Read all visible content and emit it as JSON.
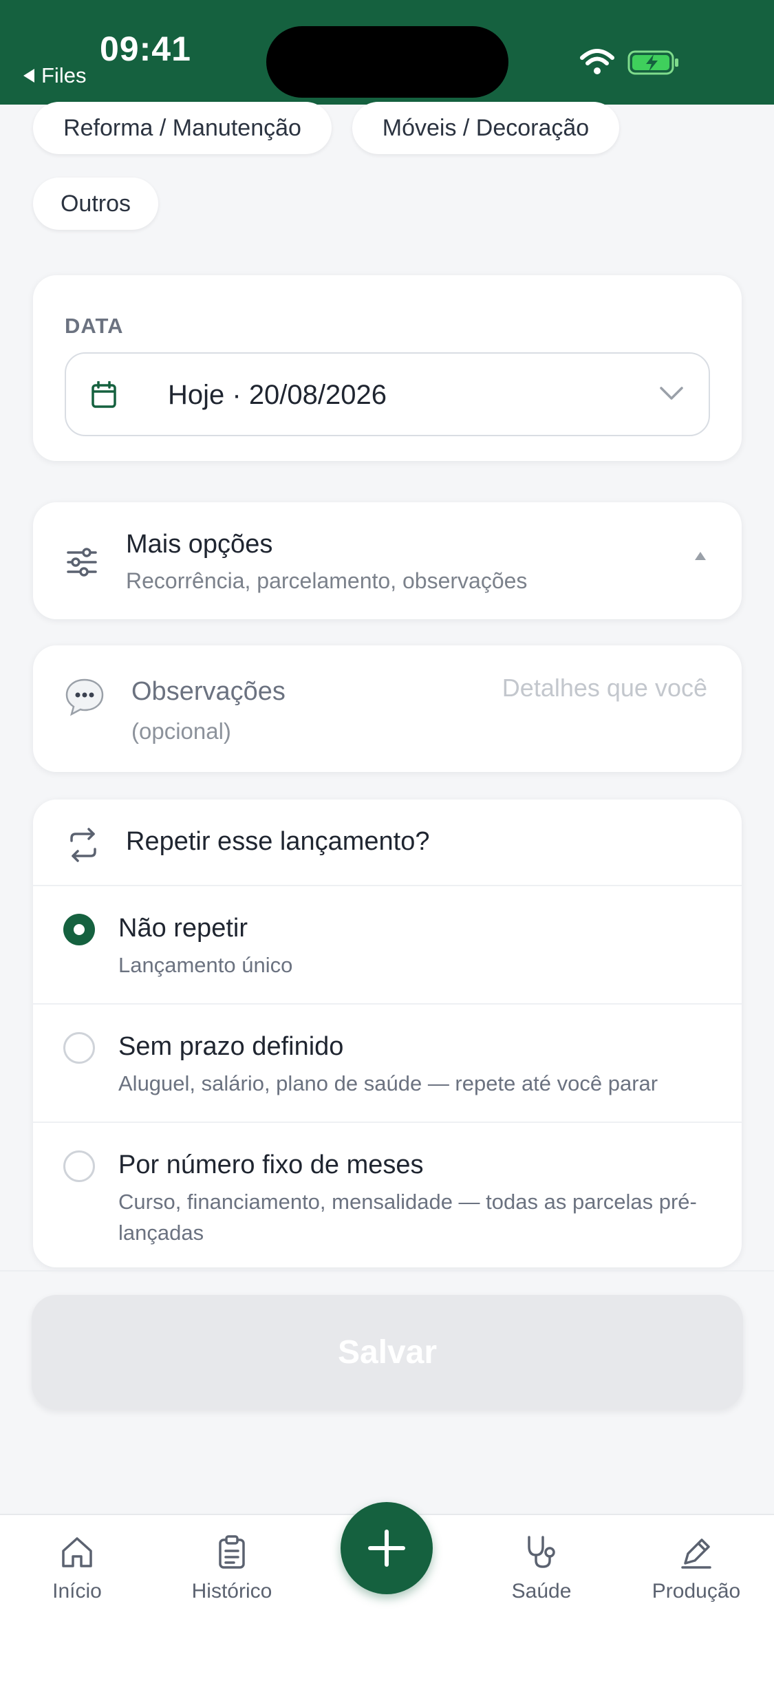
{
  "status_bar": {
    "time": "09:41",
    "back_label": "Files"
  },
  "chips": {
    "reforma": "Reforma / Manutenção",
    "moveis": "Móveis / Decoração",
    "outros": "Outros"
  },
  "date_card": {
    "label": "DATA",
    "value": "Hoje · 20/08/2026"
  },
  "more_options": {
    "title": "Mais opções",
    "subtitle": "Recorrência, parcelamento, observações"
  },
  "notes": {
    "title": "Observações",
    "subtitle": "(opcional)",
    "placeholder": "Detalhes que você"
  },
  "repeat": {
    "title": "Repetir esse lançamento?",
    "options": [
      {
        "title": "Não repetir",
        "desc": "Lançamento único",
        "selected": true
      },
      {
        "title": "Sem prazo definido",
        "desc": "Aluguel, salário, plano de saúde — repete até você parar",
        "selected": false
      },
      {
        "title": "Por número fixo de meses",
        "desc": "Curso, financiamento, mensalidade — todas as parcelas pré-lançadas",
        "selected": false
      }
    ]
  },
  "save_label": "Salvar",
  "tabs": [
    {
      "label": "Início",
      "icon": "home-icon"
    },
    {
      "label": "Histórico",
      "icon": "clipboard-icon"
    },
    {
      "label": "Saúde",
      "icon": "stethoscope-icon"
    },
    {
      "label": "Produção",
      "icon": "pen-icon"
    }
  ],
  "colors": {
    "brand": "#15613f",
    "disabled_button": "#e7e8eb",
    "background": "#f5f6f8"
  }
}
